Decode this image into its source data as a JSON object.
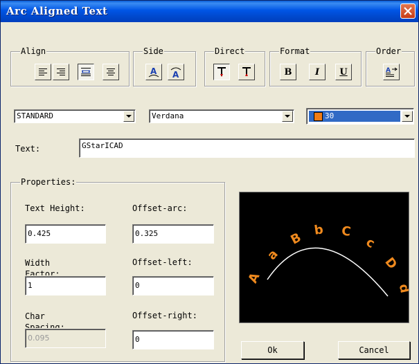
{
  "window": {
    "title": "Arc Aligned Text"
  },
  "groups": {
    "align": "Align",
    "side": "Side",
    "direct": "Direct",
    "format": "Format",
    "order": "Order",
    "properties": "Properties:"
  },
  "format_buttons": {
    "bold": "B",
    "italic": "I",
    "underline": "U"
  },
  "style_combo": {
    "value": "STANDARD"
  },
  "font_combo": {
    "value": "Verdana"
  },
  "color_combo": {
    "value": "30",
    "swatch_color": "#f07c16"
  },
  "text_label": "Text:",
  "text_value": "GStarICAD",
  "properties": {
    "text_height_label": "Text Height:",
    "text_height_value": "0.425",
    "offset_arc_label": "Offset-arc:",
    "offset_arc_value": "0.325",
    "width_factor_label": "Width Factor:",
    "width_factor_value": "1",
    "offset_left_label": "Offset-left:",
    "offset_left_value": "0",
    "char_spacing_label": "Char Spacing:",
    "char_spacing_value": "0.095",
    "offset_right_label": "Offset-right:",
    "offset_right_value": "0"
  },
  "preview": {
    "text": "AaBbCcDd",
    "text_color": "#f08a1e",
    "arc_color": "#ffffff",
    "background": "#000000"
  },
  "buttons": {
    "ok": "Ok",
    "cancel": "Cancel"
  }
}
